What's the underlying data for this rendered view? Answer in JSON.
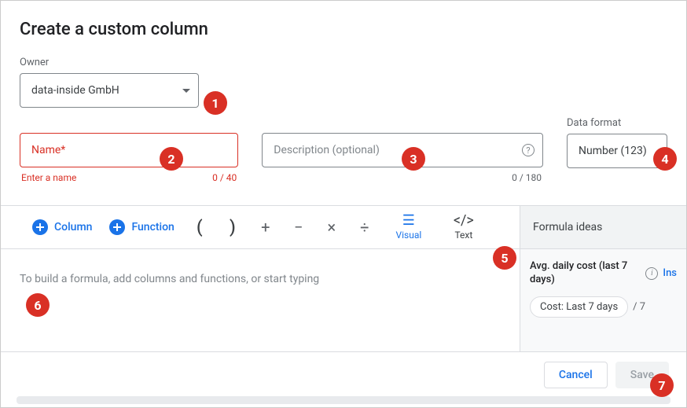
{
  "title": "Create a custom column",
  "owner": {
    "label": "Owner",
    "value": "data-inside GmbH"
  },
  "name": {
    "placeholder": "Name*",
    "error": "Enter a name",
    "counter": "0 / 40"
  },
  "description": {
    "placeholder": "Description (optional)",
    "counter": "0 / 180"
  },
  "format": {
    "label": "Data format",
    "value": "Number (123)"
  },
  "toolbar": {
    "column_label": "Column",
    "function_label": "Function",
    "open_paren": "(",
    "close_paren": ")",
    "plus": "+",
    "minus": "−",
    "times": "×",
    "divide": "÷",
    "visual_label": "Visual",
    "text_label": "Text",
    "ideas_header": "Formula ideas"
  },
  "formula": {
    "placeholder": "To build a formula, add columns and functions, or start typing"
  },
  "idea": {
    "title": "Avg. daily cost (last 7 days)",
    "insert_label": "Ins",
    "chip": "Cost: Last 7 days",
    "suffix": "/ 7"
  },
  "footer": {
    "cancel": "Cancel",
    "save": "Save"
  },
  "annotations": {
    "b1": "1",
    "b2": "2",
    "b3": "3",
    "b4": "4",
    "b5": "5",
    "b6": "6",
    "b7": "7"
  }
}
